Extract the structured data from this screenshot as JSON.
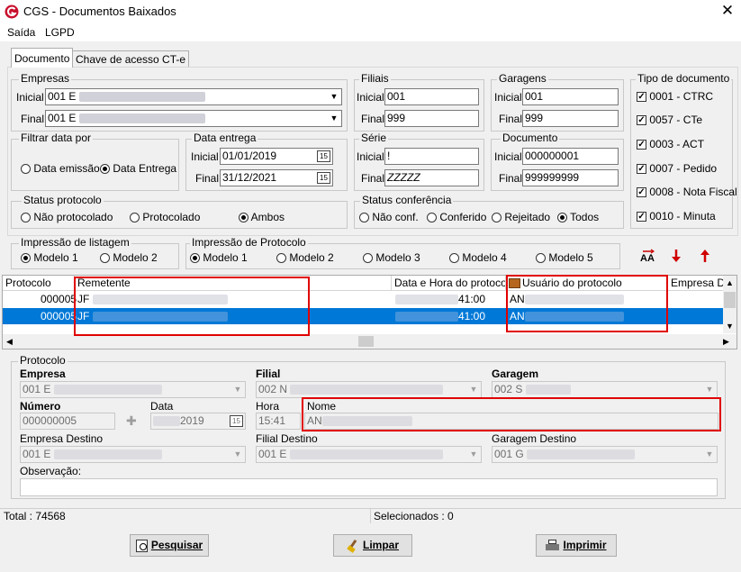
{
  "window": {
    "title": "CGS - Documentos Baixados",
    "close": "✕"
  },
  "menu": [
    "Saída",
    "LGPD"
  ],
  "tabs": [
    "Documento",
    "Chave de acesso CT-e"
  ],
  "empresas": {
    "label": "Empresas",
    "inicial_label": "Inicial",
    "inicial_value": "001 E",
    "final_label": "Final",
    "final_value": "001 E"
  },
  "filiais": {
    "label": "Filiais",
    "inicial_label": "Inicial",
    "inicial_value": "001",
    "final_label": "Final",
    "final_value": "999"
  },
  "garagens": {
    "label": "Garagens",
    "inicial_label": "Inicial",
    "inicial_value": "001",
    "final_label": "Final",
    "final_value": "999"
  },
  "tipo_documento": {
    "label": "Tipo de documento",
    "items": [
      "0001 - CTRC",
      "0057 - CTe",
      "0003 - ACT",
      "0007 - Pedido",
      "0008 - Nota Fiscal",
      "0010 - Minuta"
    ]
  },
  "filtrar_data": {
    "label": "Filtrar data por",
    "opt1": "Data emissão",
    "opt2": "Data Entrega"
  },
  "data_entrega": {
    "label": "Data entrega",
    "inicial_label": "Inicial",
    "inicial_value": "01/01/2019",
    "final_label": "Final",
    "final_value": "31/12/2021"
  },
  "serie": {
    "label": "Série",
    "inicial_label": "Inicial",
    "inicial_value": "!",
    "final_label": "Final",
    "final_value": "ZZZZZ"
  },
  "documento": {
    "label": "Documento",
    "inicial_label": "Inicial",
    "inicial_value": "000000001",
    "final_label": "Final",
    "final_value": "999999999"
  },
  "status_protocolo": {
    "label": "Status protocolo",
    "opt1": "Não protocolado",
    "opt2": "Protocolado",
    "opt3": "Ambos"
  },
  "status_conferencia": {
    "label": "Status conferência",
    "opt1": "Não conf.",
    "opt2": "Conferido",
    "opt3": "Rejeitado",
    "opt4": "Todos"
  },
  "impressao_listagem": {
    "label": "Impressão de listagem",
    "opt1": "Modelo 1",
    "opt2": "Modelo 2"
  },
  "impressao_protocolo": {
    "label": "Impressão de Protocolo",
    "opt1": "Modelo 1",
    "opt2": "Modelo 2",
    "opt3": "Modelo 3",
    "opt4": "Modelo 4",
    "opt5": "Modelo 5"
  },
  "grid": {
    "headers": [
      "Protocolo",
      "Remetente",
      "Data e Hora do protocolo",
      "Usuário do protocolo",
      "Empresa De"
    ],
    "rows": [
      {
        "protocolo": "000005",
        "remetente": "JF",
        "hora": "41:00",
        "usuario": "AN"
      },
      {
        "protocolo": "000005",
        "remetente": "JF",
        "hora": "41:00",
        "usuario": "AN"
      }
    ]
  },
  "protocolo": {
    "label": "Protocolo",
    "empresa_label": "Empresa",
    "empresa_value": "001 E",
    "filial_label": "Filial",
    "filial_value": "002 N",
    "garagem_label": "Garagem",
    "garagem_value": "002 S",
    "numero_label": "Número",
    "numero_value": "000000005",
    "data_label": "Data",
    "data_value": "2019",
    "hora_label": "Hora",
    "hora_value": "15:41",
    "nome_label": "Nome",
    "nome_value": "AN",
    "empresa_destino_label": "Empresa Destino",
    "empresa_destino_value": "001 E",
    "filial_destino_label": "Filial Destino",
    "filial_destino_value": "001 E",
    "garagem_destino_label": "Garagem Destino",
    "garagem_destino_value": "001 G",
    "observacao_label": "Observação:"
  },
  "status": {
    "total": "Total : 74568",
    "selecionados": "Selecionados : 0"
  },
  "buttons": {
    "pesquisar": "Pesquisar",
    "limpar": "Limpar",
    "imprimir": "Imprimir"
  },
  "colors": {
    "selection": "#0078d7",
    "highlight_box": "#e00000",
    "logo": "#c8102e"
  }
}
